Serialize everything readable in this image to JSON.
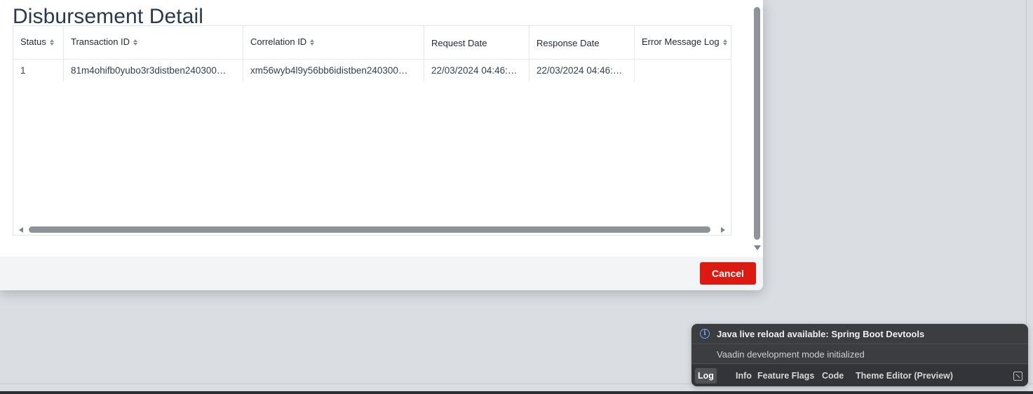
{
  "dialog": {
    "title": "Disbursement Detail",
    "cancel_label": "Cancel",
    "accent_color": "#dc1a12"
  },
  "grid": {
    "columns": [
      {
        "label": "Status",
        "sortable": true
      },
      {
        "label": "Transaction ID",
        "sortable": true
      },
      {
        "label": "Correlation ID",
        "sortable": true
      },
      {
        "label": "Request Date",
        "sortable": false
      },
      {
        "label": "Response Date",
        "sortable": false
      },
      {
        "label": "Error Message Log",
        "sortable": true
      }
    ],
    "rows": [
      {
        "status": "1",
        "transaction_id": "81m4ohifb0yubo3r3distben240300…",
        "correlation_id": "xm56wyb4l9y56bb6idistben240300…",
        "request_date": "22/03/2024 04:46:…",
        "response_date": "22/03/2024 04:46:…",
        "error_message_log": ""
      }
    ]
  },
  "devtools": {
    "notification_1": "Java live reload available: Spring Boot Devtools",
    "notification_2": "Vaadin development mode initialized",
    "tabs": [
      "Log",
      "Info",
      "Feature Flags",
      "Code",
      "Theme Editor (Preview)"
    ],
    "active_tab": "Log",
    "icons": [
      "info-icon",
      "dock-icon"
    ]
  }
}
